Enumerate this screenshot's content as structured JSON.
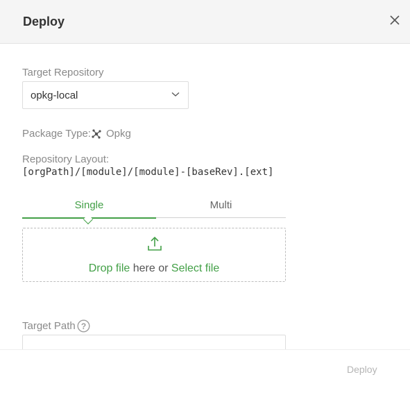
{
  "dialog": {
    "title": "Deploy"
  },
  "form": {
    "target_repository_label": "Target Repository",
    "target_repository_value": "opkg-local",
    "package_type_label": "Package Type:",
    "package_type_value": "Opkg",
    "repository_layout_label": "Repository Layout:",
    "repository_layout_value": "[orgPath]/[module]/[module]-[baseRev].[ext]",
    "tabs": [
      {
        "label": "Single",
        "active": true
      },
      {
        "label": "Multi",
        "active": false
      }
    ],
    "dropzone": {
      "drop_file": "Drop file",
      "here_or": " here or ",
      "select_file": "Select file"
    },
    "target_path_label": "Target Path",
    "target_path_value": ""
  },
  "footer": {
    "deploy_label": "Deploy"
  },
  "icons": {
    "close": "close-icon",
    "chevron": "chevron-down-icon",
    "package": "opkg-icon",
    "upload": "upload-icon",
    "help": "help-icon"
  },
  "colors": {
    "accent": "#43a047",
    "header_bg": "#f5f5f5",
    "disabled_text": "#b5b5b5"
  }
}
